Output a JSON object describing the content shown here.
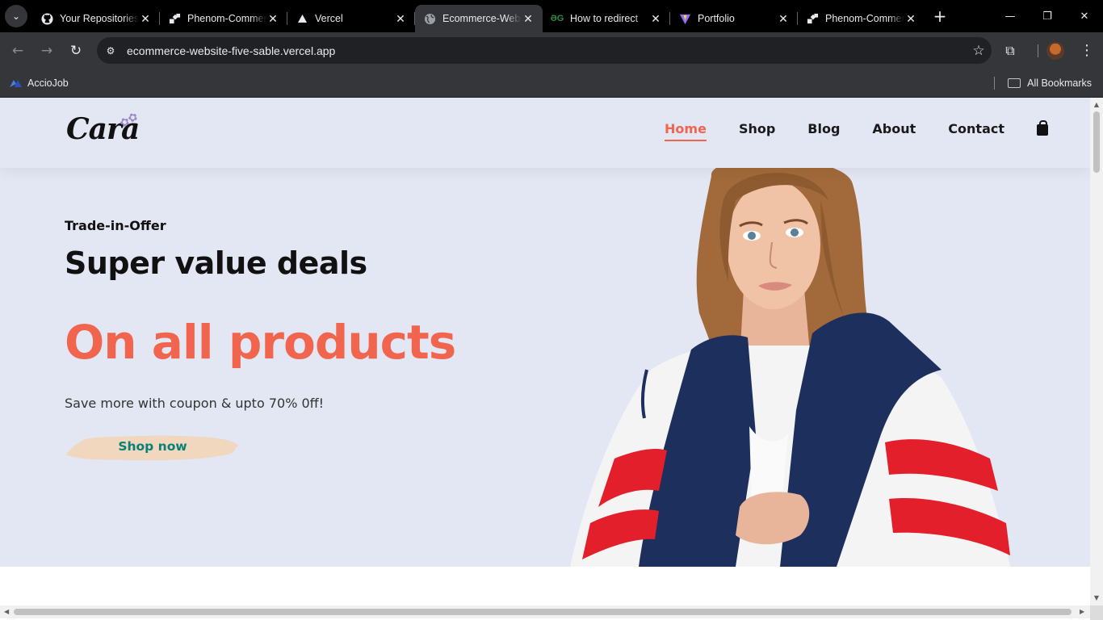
{
  "browser": {
    "tabs": [
      {
        "title": "Your Repositories",
        "icon": "github-icon",
        "active": false
      },
      {
        "title": "Phenom-Commerce",
        "icon": "phenom-icon",
        "active": false
      },
      {
        "title": "Vercel",
        "icon": "vercel-icon",
        "active": false
      },
      {
        "title": "Ecommerce-Website",
        "icon": "globe-icon",
        "active": true
      },
      {
        "title": "How to redirect",
        "icon": "geeksforgeeks-icon",
        "active": false
      },
      {
        "title": "Portfolio",
        "icon": "vite-icon",
        "active": false
      },
      {
        "title": "Phenom-Commerce",
        "icon": "phenom-icon",
        "active": false
      }
    ],
    "url": "ecommerce-website-five-sable.vercel.app",
    "bookmarks": [
      {
        "label": "AccioJob",
        "icon": "acciojob-icon"
      }
    ],
    "all_bookmarks_label": "All Bookmarks"
  },
  "site": {
    "logo_text": "Cara",
    "nav": [
      {
        "label": "Home",
        "active": true
      },
      {
        "label": "Shop",
        "active": false
      },
      {
        "label": "Blog",
        "active": false
      },
      {
        "label": "About",
        "active": false
      },
      {
        "label": "Contact",
        "active": false
      }
    ],
    "hero": {
      "eyebrow": "Trade-in-Offer",
      "headline": "Super value deals",
      "highlight": "On all products",
      "subtext": "Save more with coupon & upto 70% 0ff!",
      "cta_label": "Shop now"
    },
    "colors": {
      "accent": "#f1644d",
      "hero_bg": "#e3e6f3",
      "cta_text": "#088178",
      "cta_bg": "#f0d7bd"
    }
  }
}
